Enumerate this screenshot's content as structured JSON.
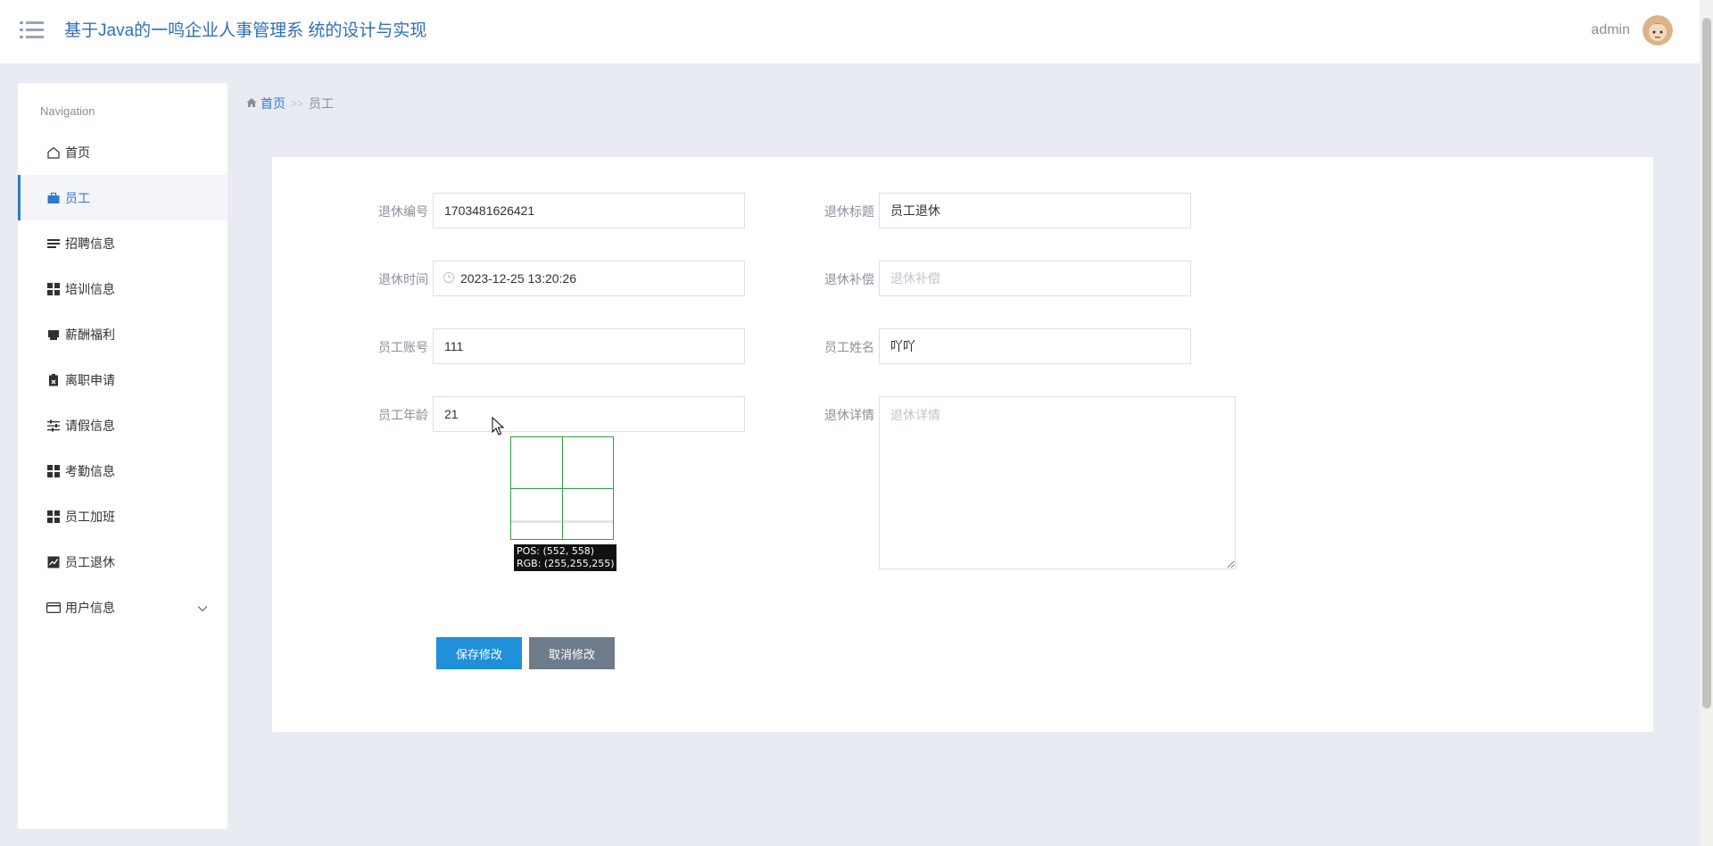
{
  "header": {
    "app_title": "基于Java的一鸣企业人事管理系 统的设计与实现",
    "user_name": "admin"
  },
  "sidebar": {
    "heading": "Navigation",
    "items": [
      {
        "label": "首页",
        "icon": "home-icon"
      },
      {
        "label": "员工",
        "icon": "briefcase-icon",
        "active": true
      },
      {
        "label": "招聘信息",
        "icon": "list-icon"
      },
      {
        "label": "培训信息",
        "icon": "grid-icon"
      },
      {
        "label": "薪酬福利",
        "icon": "printer-icon"
      },
      {
        "label": "离职申请",
        "icon": "clipboard-icon"
      },
      {
        "label": "请假信息",
        "icon": "sliders-icon"
      },
      {
        "label": "考勤信息",
        "icon": "grid-icon"
      },
      {
        "label": "员工加班",
        "icon": "grid-icon"
      },
      {
        "label": "员工退休",
        "icon": "chart-icon"
      },
      {
        "label": "用户信息",
        "icon": "card-icon",
        "expandable": true
      }
    ]
  },
  "breadcrumb": {
    "home": "首页",
    "separator": ">>",
    "current": "员工"
  },
  "form": {
    "retire_no_label": "退休编号",
    "retire_no_value": "1703481626421",
    "retire_title_label": "退休标题",
    "retire_title_value": "员工退休",
    "retire_time_label": "退休时间",
    "retire_time_value": "2023-12-25 13:20:26",
    "retire_comp_label": "退休补偿",
    "retire_comp_placeholder": "退休补偿",
    "emp_account_label": "员工账号",
    "emp_account_value": "111",
    "emp_name_label": "员工姓名",
    "emp_name_value": "吖吖",
    "emp_age_label": "员工年龄",
    "emp_age_value": "21",
    "retire_detail_label": "退休详情",
    "retire_detail_placeholder": "退休详情",
    "save_label": "保存修改",
    "cancel_label": "取消修改"
  },
  "overlay": {
    "pos_text": "POS: (552, 558)",
    "rgb_text": "RGB: (255,255,255)"
  },
  "colors": {
    "accent": "#2f7ad0",
    "save_button": "#1f90d9",
    "cancel_button": "#6e7b8b",
    "page_bg": "#e9ebf3"
  }
}
